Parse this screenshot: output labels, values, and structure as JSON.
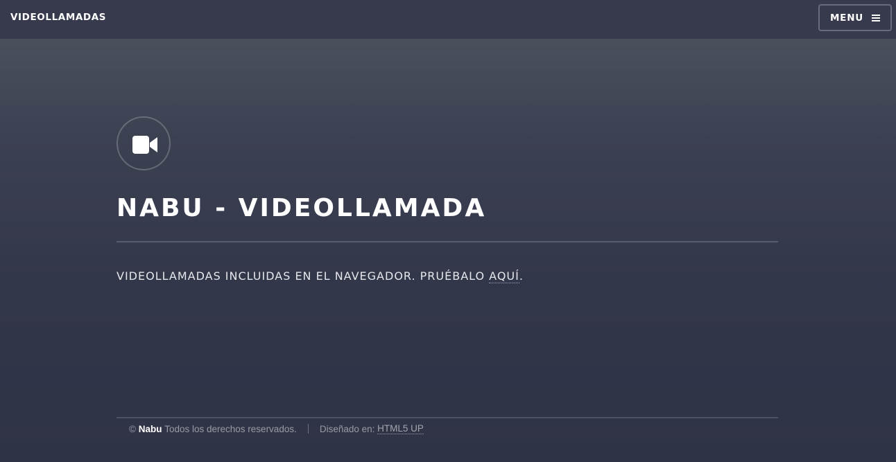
{
  "header": {
    "brand": "VIDEOLLAMADAS",
    "menu_label": "MENU",
    "menu_icon": "hamburger-icon"
  },
  "banner": {
    "icon": "video-camera-icon",
    "title": "NABU - VIDEOLLAMADA",
    "subtitle_prefix": "VIDEOLLAMADAS INCLUIDAS EN EL NAVEGADOR. PRUÉBALO ",
    "subtitle_link": "AQUÍ",
    "subtitle_suffix": "."
  },
  "footer": {
    "copyright_symbol": "©",
    "owner": "Nabu",
    "rights": "Todos los derechos reservados.",
    "designed_label": "Diseñado en:",
    "designer_link": "HTML5 UP"
  },
  "colors": {
    "header_bg": "#363a4c",
    "page_bg_top": "#4b505d",
    "page_bg_bottom": "#2f3346"
  }
}
